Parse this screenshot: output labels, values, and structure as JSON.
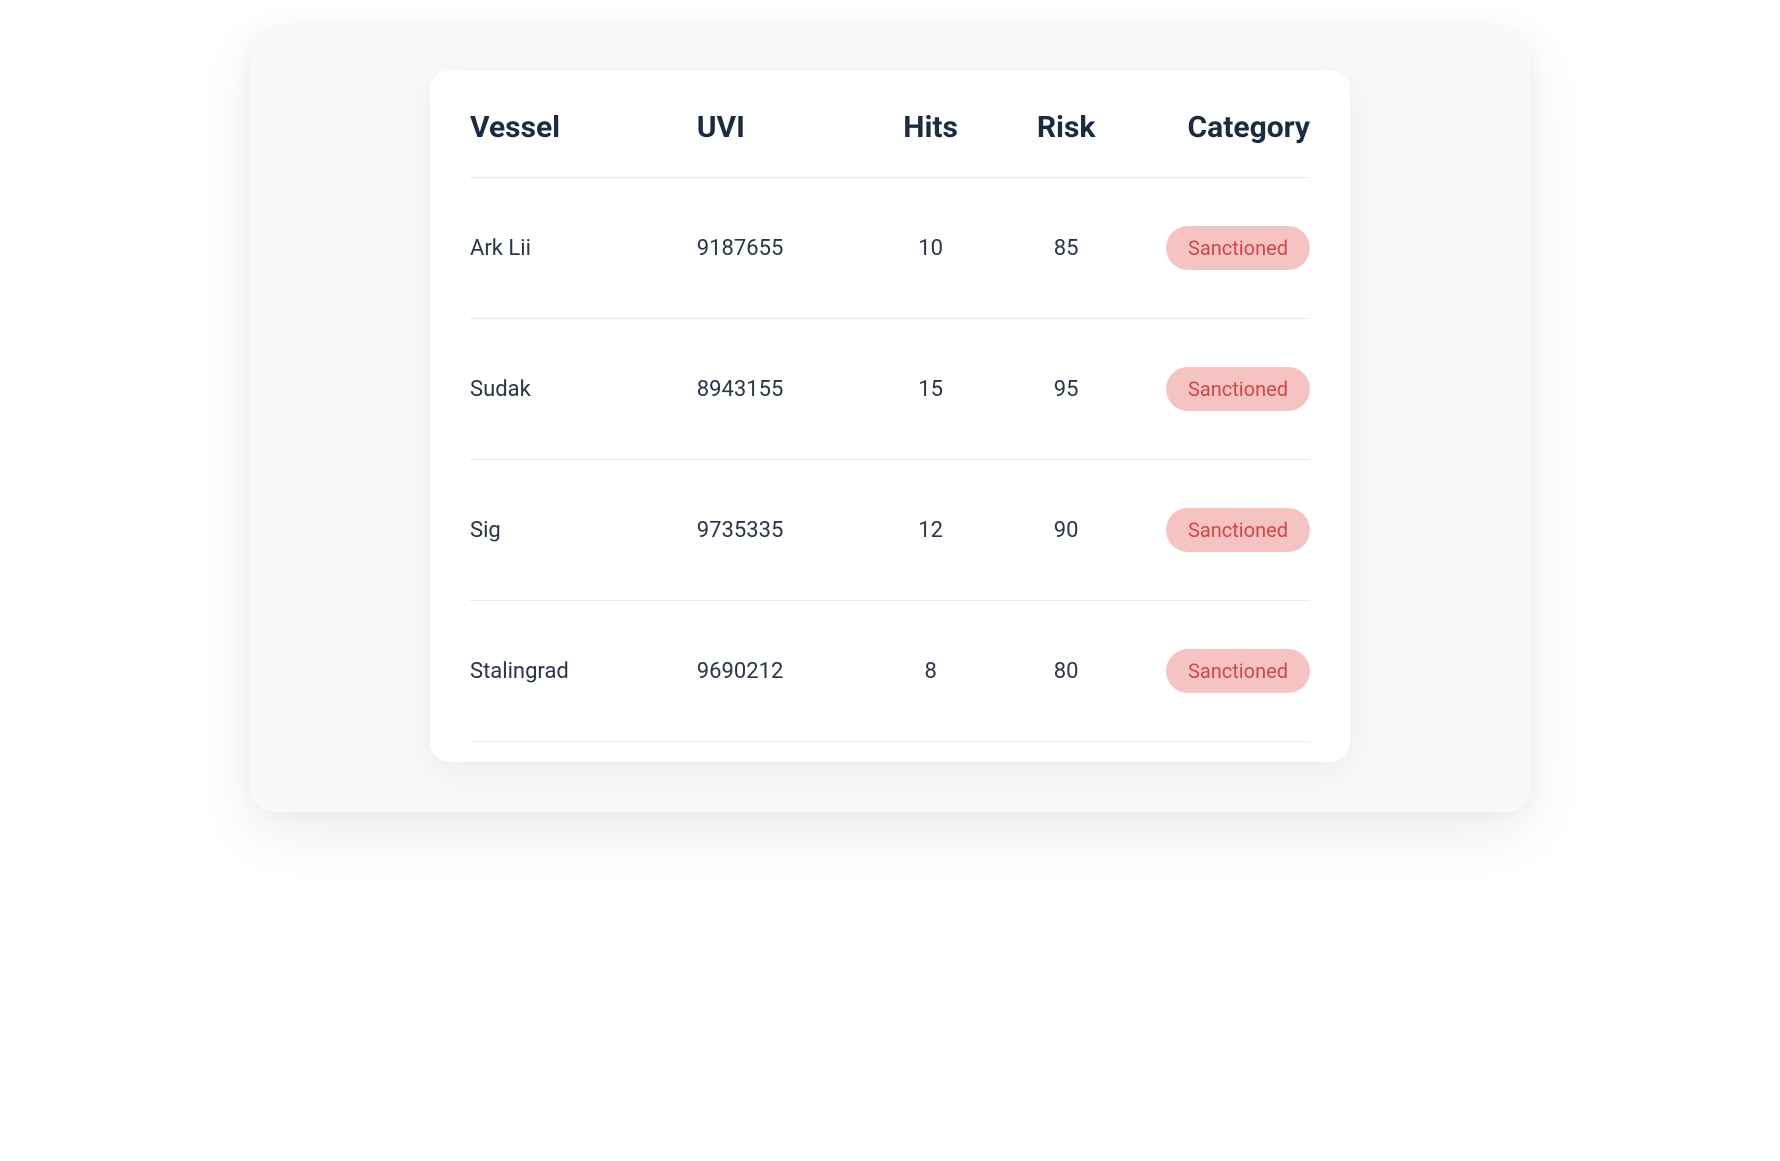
{
  "table": {
    "headers": {
      "vessel": "Vessel",
      "uvi": "UVI",
      "hits": "Hits",
      "risk": "Risk",
      "category": "Category"
    },
    "rows": [
      {
        "vessel": "Ark Lii",
        "uvi": "9187655",
        "hits": "10",
        "risk": "85",
        "category": "Sanctioned"
      },
      {
        "vessel": "Sudak",
        "uvi": "8943155",
        "hits": "15",
        "risk": "95",
        "category": "Sanctioned"
      },
      {
        "vessel": "Sig",
        "uvi": "9735335",
        "hits": "12",
        "risk": "90",
        "category": "Sanctioned"
      },
      {
        "vessel": "Stalingrad",
        "uvi": "9690212",
        "hits": "8",
        "risk": "80",
        "category": "Sanctioned"
      }
    ]
  }
}
